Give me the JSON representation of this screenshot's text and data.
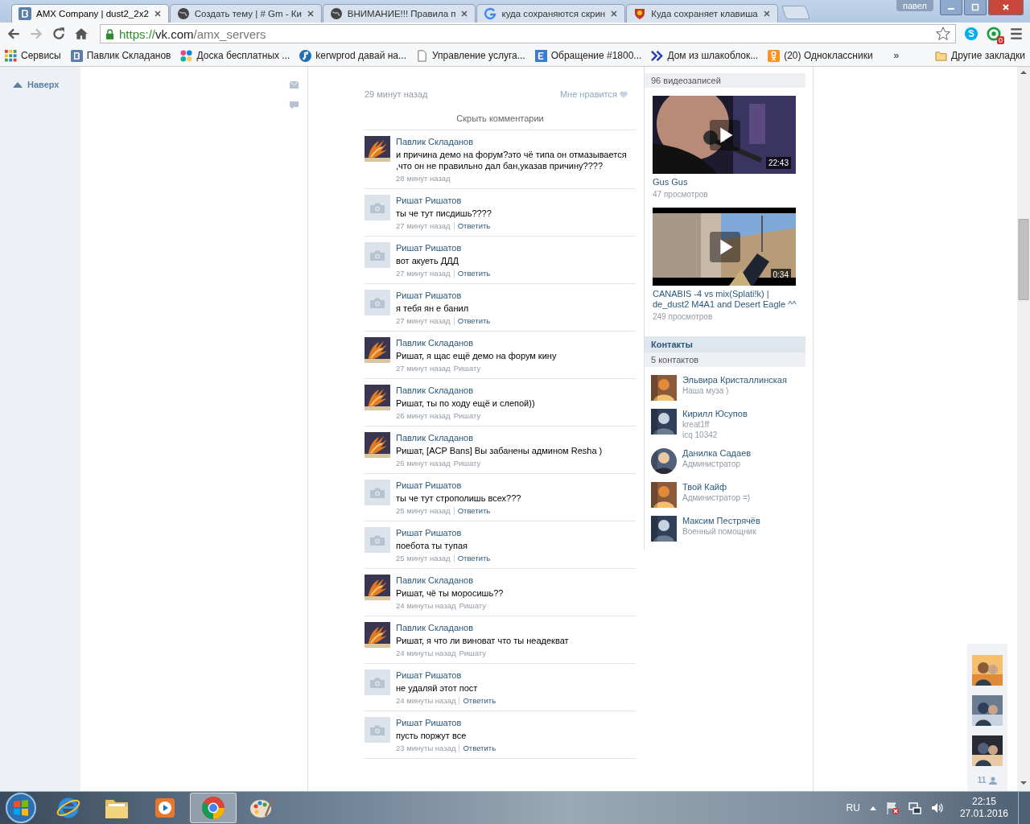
{
  "browser": {
    "tabs": [
      {
        "title": "AMX Company | dust2_2x2",
        "kind": "vk",
        "selected": true
      },
      {
        "title": "Создать тему | # Gm - Ки",
        "kind": "globe",
        "selected": false
      },
      {
        "title": "ВНИМАНИЕ!!! Правила п",
        "kind": "globe",
        "selected": false
      },
      {
        "title": "куда сохраняются скрин",
        "kind": "google",
        "selected": false
      },
      {
        "title": "Куда сохраняет клавиша",
        "kind": "shield",
        "selected": false
      }
    ],
    "user": "павел",
    "url": {
      "scheme": "https://",
      "host": "vk.com",
      "path": "/amx_servers"
    },
    "extension_badge": "0",
    "bookmarks": [
      {
        "label": "Сервисы",
        "kind": "apps"
      },
      {
        "label": "Павлик Складанов",
        "kind": "vk"
      },
      {
        "label": "Доска бесплатных ...",
        "kind": "dots"
      },
      {
        "label": "kerwprod давай на...",
        "kind": "music"
      },
      {
        "label": "Управление услуга...",
        "kind": "page"
      },
      {
        "label": "Обращение #1800...",
        "kind": "letter"
      },
      {
        "label": "Дом из шлакоблок...",
        "kind": "chevrons"
      },
      {
        "label": "(20) Одноклассники",
        "kind": "ok"
      }
    ],
    "bookmarks_more": "»",
    "other_bookmarks": "Другие закладки"
  },
  "page": {
    "back_to_top": "Наверх",
    "post": {
      "time": "29 минут назад",
      "like": "Мне нравится",
      "hide_comments": "Скрыть комментарии",
      "comments": [
        {
          "author": "Павлик Складанов",
          "text": "и причина демо на форум?это чё типа он отмазывается ,что он не правильно дал бан,указав причину????",
          "time": "28 минут назад"
        },
        {
          "author": "Ришат Ришатов",
          "kind": "placeholder",
          "text": "ты че тут писдишь????",
          "time": "27 минут назад",
          "reply": "Ответить"
        },
        {
          "author": "Ришат Ришатов",
          "kind": "placeholder",
          "text": "вот акуеть ДДД",
          "time": "27 минут назад",
          "reply": "Ответить"
        },
        {
          "author": "Ришат Ришатов",
          "kind": "placeholder",
          "text": "я тебя ян е банил",
          "time": "27 минут назад",
          "reply": "Ответить"
        },
        {
          "author": "Павлик Складанов",
          "text": "Ришат, я щас ещё демо на форум кину",
          "time": "27 минут назад",
          "addressee": "Ришату"
        },
        {
          "author": "Павлик Складанов",
          "text": "Ришат, ты по ходу ещё и слепой))",
          "time": "26 минут назад",
          "addressee": "Ришату"
        },
        {
          "author": "Павлик Складанов",
          "text": "Ришат, [ACP Bans] Вы забанены админом Resha )",
          "time": "26 минут назад",
          "addressee": "Ришату"
        },
        {
          "author": "Ришат Ришатов",
          "kind": "placeholder",
          "text": "ты че тут строполишь всех???",
          "time": "25 минут назад",
          "reply": "Ответить"
        },
        {
          "author": "Ришат Ришатов",
          "kind": "placeholder",
          "text": "поебота ты тупая",
          "time": "25 минут назад",
          "reply": "Ответить"
        },
        {
          "author": "Павлик Складанов",
          "text": "Ришат, чё ты моросишь??",
          "time": "24 минуты назад",
          "addressee": "Ришату"
        },
        {
          "author": "Павлик Складанов",
          "text": "Ришат, я что ли виноват что ты неадекват",
          "time": "24 минуты назад",
          "addressee": "Ришату"
        },
        {
          "author": "Ришат Ришатов",
          "kind": "placeholder",
          "text": "не удаляй этот пост",
          "time": "24 минуты назад",
          "reply": "Ответить"
        },
        {
          "author": "Ришат Ришатов",
          "kind": "placeholder",
          "text": "пусть поржут все",
          "time": "23 минуты назад",
          "reply": "Ответить"
        }
      ]
    },
    "videos": {
      "count": "96 видеозаписей",
      "items": [
        {
          "duration": "22:43",
          "title": "Gus Gus",
          "views": "47 просмотров",
          "kind": "stage"
        },
        {
          "duration": "0:34",
          "title": "CANABIS -4 vs mix(Splati!k) | de_dust2 M4A1 and Desert Eagle ^^",
          "views": "249 просмотров",
          "kind": "game"
        }
      ]
    },
    "contacts": {
      "title": "Контакты",
      "count": "5 контактов",
      "items": [
        {
          "name": "Эльвира Кристаллинская",
          "lines": [
            "Наша муза )"
          ]
        },
        {
          "name": "Кирилл Юсупов",
          "lines": [
            "kreat1ff",
            "icq 10342"
          ]
        },
        {
          "name": "Данилка Садаев",
          "lines": [
            "Администратор"
          ]
        },
        {
          "name": "Твой Кайф",
          "lines": [
            "Администратор =)"
          ]
        },
        {
          "name": "Максим Пестрячёв",
          "lines": [
            "Военный помощник"
          ]
        }
      ]
    },
    "online_count": "11"
  },
  "taskbar": {
    "apps": [
      {
        "kind": "ie",
        "selected": false
      },
      {
        "kind": "folder",
        "selected": false
      },
      {
        "kind": "player",
        "selected": false
      },
      {
        "kind": "chrome",
        "selected": true
      },
      {
        "kind": "paint",
        "selected": false
      }
    ],
    "language": "RU",
    "time": "22:15",
    "date": "27.01.2016"
  }
}
